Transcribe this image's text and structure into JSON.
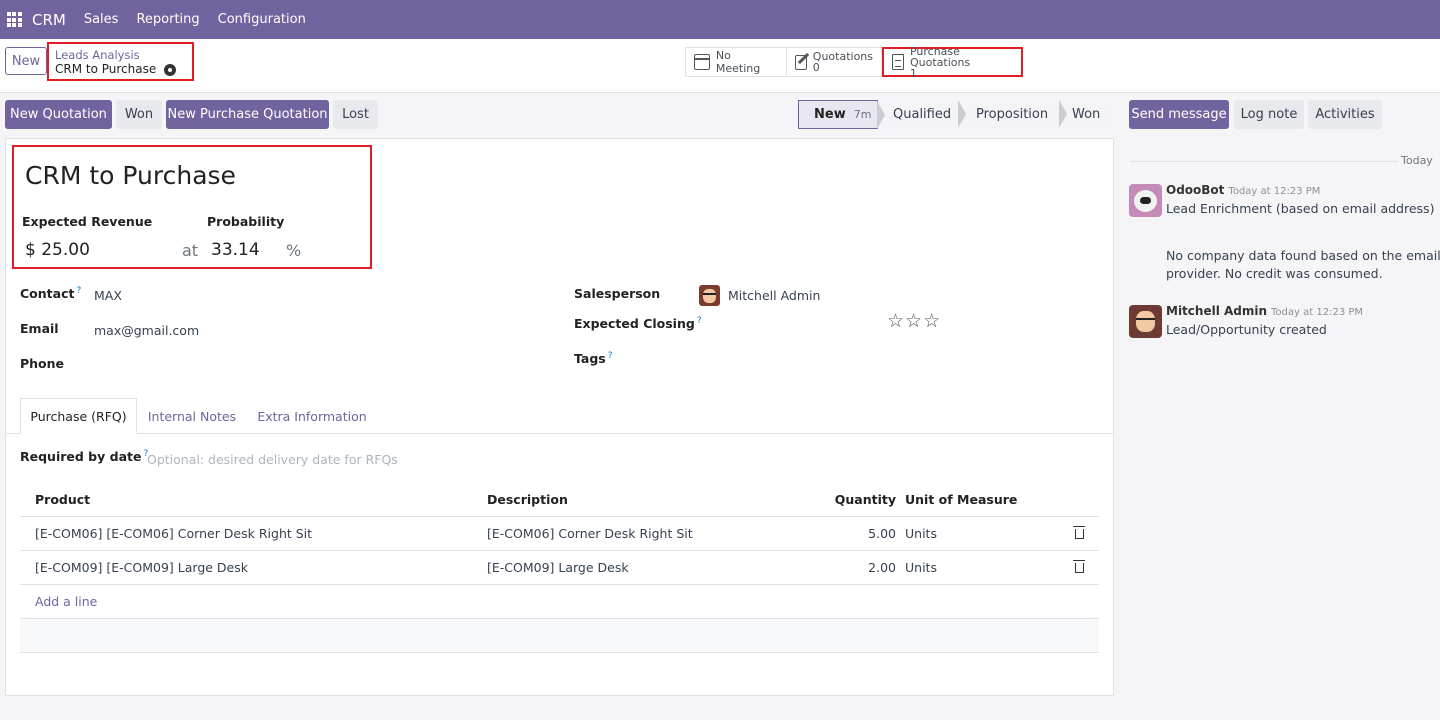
{
  "navbar": {
    "brand": "CRM",
    "menu": [
      "Sales",
      "Reporting",
      "Configuration"
    ]
  },
  "control": {
    "new_label": "New",
    "breadcrumb_parent": "Leads Analysis",
    "breadcrumb_current": "CRM to Purchase",
    "smart_buttons": [
      {
        "label": "No Meeting",
        "value": ""
      },
      {
        "label": "Quotations",
        "value": "0"
      },
      {
        "label": "Purchase Quotations",
        "value": "1"
      }
    ]
  },
  "actions": [
    "New Quotation",
    "Won",
    "New Purchase Quotation",
    "Lost"
  ],
  "stages": {
    "current": "New",
    "current_duration": "7m",
    "others": [
      "Qualified",
      "Proposition",
      "Won"
    ]
  },
  "form": {
    "title": "CRM to Purchase",
    "expected_revenue_label": "Expected Revenue",
    "expected_revenue": "$ 25.00",
    "at": "at",
    "probability_label": "Probability",
    "probability": "33.14",
    "percent": "%",
    "contact_label": "Contact",
    "contact": "MAX",
    "email_label": "Email",
    "email": "max@gmail.com",
    "phone_label": "Phone",
    "salesperson_label": "Salesperson",
    "salesperson": "Mitchell Admin",
    "expected_closing_label": "Expected Closing",
    "tags_label": "Tags",
    "help_mark": "?",
    "stars": "☆☆☆"
  },
  "tabs": [
    "Purchase (RFQ)",
    "Internal Notes",
    "Extra Information"
  ],
  "rfq": {
    "required_by_label": "Required by date",
    "required_by_placeholder": "Optional: desired delivery date for RFQs",
    "columns": [
      "Product",
      "Description",
      "Quantity",
      "Unit of Measure"
    ],
    "rows": [
      {
        "product": "[E-COM06] [E-COM06] Corner Desk Right Sit",
        "description": "[E-COM06] Corner Desk Right Sit",
        "quantity": "5.00",
        "uom": "Units"
      },
      {
        "product": "[E-COM09] [E-COM09] Large Desk",
        "description": "[E-COM09] Large Desk",
        "quantity": "2.00",
        "uom": "Units"
      }
    ],
    "add_line": "Add a line"
  },
  "chatter": {
    "buttons": [
      "Send message",
      "Log note",
      "Activities"
    ],
    "date_separator": "Today",
    "messages": [
      {
        "author": "OdooBot",
        "time": "Today at 12:23 PM",
        "lines": [
          "Lead Enrichment (based on email address)",
          "",
          "No company data found based on the email addr",
          "provider. No credit was consumed."
        ]
      },
      {
        "author": "Mitchell Admin",
        "time": "Today at 12:23 PM",
        "lines": [
          "Lead/Opportunity created"
        ]
      }
    ]
  },
  "colors": {
    "brand": "#71639e",
    "highlight": "#e11d26"
  }
}
